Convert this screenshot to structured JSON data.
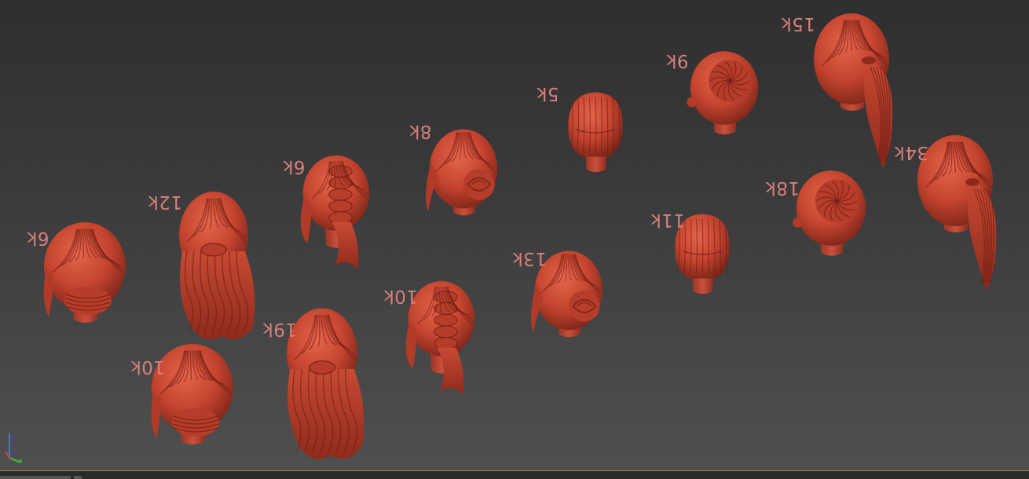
{
  "viewport": {
    "background_top": "#2f2f2f",
    "background_bottom": "#505050",
    "hair_color": "#c4442f",
    "hair_shadow": "#6e1c12",
    "label_color": "#d6807c"
  },
  "models": [
    {
      "label": "6k",
      "style": "low-bun"
    },
    {
      "label": "12k",
      "style": "half-up-wavy"
    },
    {
      "label": "10k",
      "style": "low-bun"
    },
    {
      "label": "19k",
      "style": "half-up-wavy"
    },
    {
      "label": "6k",
      "style": "braided-half-up"
    },
    {
      "label": "10k",
      "style": "braided-half-up"
    },
    {
      "label": "8k",
      "style": "side-bun"
    },
    {
      "label": "13k",
      "style": "side-bun"
    },
    {
      "label": "5k",
      "style": "short-crop"
    },
    {
      "label": "11k",
      "style": "short-crop"
    },
    {
      "label": "9k",
      "style": "swirl-bun"
    },
    {
      "label": "18k",
      "style": "swirl-bun"
    },
    {
      "label": "15k",
      "style": "ponytail"
    },
    {
      "label": "34k",
      "style": "ponytail"
    }
  ],
  "gizmo": {
    "axes": [
      "x",
      "y",
      "z"
    ],
    "x_color": "#d84040",
    "y_color": "#3fbf3f",
    "z_color": "#4b6cff"
  }
}
